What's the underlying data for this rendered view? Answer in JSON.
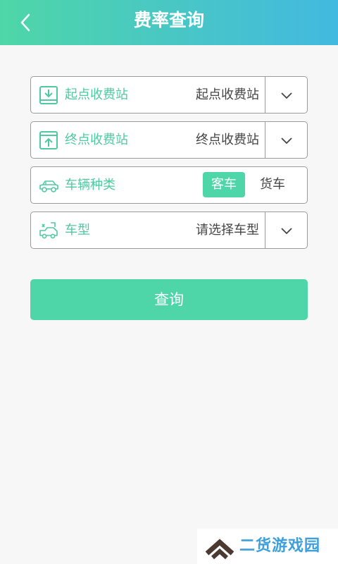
{
  "header": {
    "title": "费率查询",
    "back_icon": "chevron-left-icon"
  },
  "form": {
    "start_station": {
      "label": "起点收费站",
      "value": "起点收费站",
      "icon": "download-box-icon"
    },
    "end_station": {
      "label": "终点收费站",
      "value": "终点收费站",
      "icon": "upload-box-icon"
    },
    "vehicle_category": {
      "label": "车辆种类",
      "icon": "car-icon",
      "options": [
        "客车",
        "货车"
      ],
      "selected": "客车"
    },
    "vehicle_type": {
      "label": "车型",
      "value": "请选择车型",
      "icon": "vehicle-type-icon"
    }
  },
  "actions": {
    "query_label": "查询"
  },
  "watermark": {
    "text": "二货游戏园"
  },
  "colors": {
    "accent": "#4fd6a8",
    "header_gradient_end": "#42b9e0",
    "label": "#4fcaa0",
    "watermark_text": "#3d9fdc"
  }
}
